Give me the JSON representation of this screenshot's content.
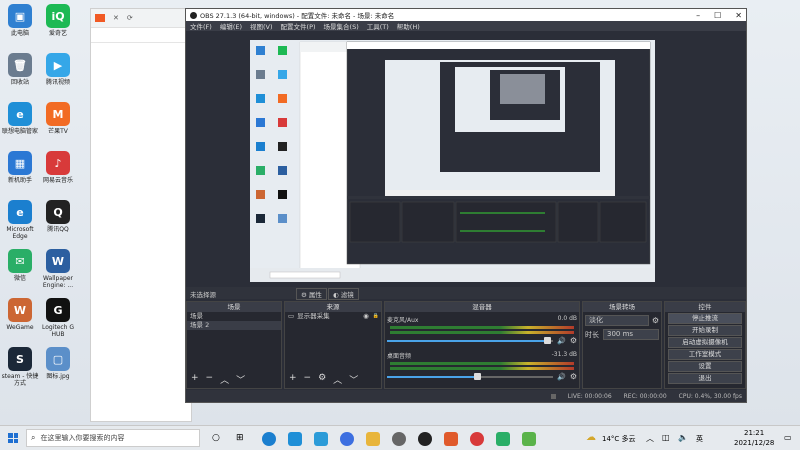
{
  "desktop_icons": [
    {
      "label": "此电脑",
      "color": "#2f80d1",
      "glyph": "▣",
      "icon": "computer-icon"
    },
    {
      "label": "爱奇艺",
      "color": "#1db954",
      "glyph": "iQ",
      "icon": "iqiyi-icon"
    },
    {
      "label": "回收站",
      "color": "#6b7c8f",
      "glyph": "🗑",
      "icon": "recycle-bin-icon"
    },
    {
      "label": "腾讯视频",
      "color": "#35a7e8",
      "glyph": "▶",
      "icon": "tencent-video-icon"
    },
    {
      "label": "联想电脑管家",
      "color": "#1f8fd7",
      "glyph": "e",
      "icon": "lenovo-manager-icon"
    },
    {
      "label": "芒果TV",
      "color": "#f26b24",
      "glyph": "M",
      "icon": "mango-tv-icon"
    },
    {
      "label": "新机助手",
      "color": "#2b78d4",
      "glyph": "▦",
      "icon": "new-pc-assistant-icon"
    },
    {
      "label": "网易云音乐",
      "color": "#d83a3a",
      "glyph": "♪",
      "icon": "netease-music-icon"
    },
    {
      "label": "Microsoft Edge",
      "color": "#1b7fcf",
      "glyph": "e",
      "icon": "edge-icon"
    },
    {
      "label": "腾讯QQ",
      "color": "#222",
      "glyph": "Q",
      "icon": "qq-icon"
    },
    {
      "label": "微信",
      "color": "#2aae67",
      "glyph": "✉",
      "icon": "wechat-icon"
    },
    {
      "label": "Wallpaper Engine: ...",
      "color": "#2c5fa0",
      "glyph": "W",
      "icon": "wallpaper-engine-icon"
    },
    {
      "label": "WeGame",
      "color": "#c63",
      "glyph": "W",
      "icon": "wegame-icon"
    },
    {
      "label": "Logitech G HUB",
      "color": "#111",
      "glyph": "G",
      "icon": "logitech-ghub-icon"
    },
    {
      "label": "steam - 快捷方式",
      "color": "#1b2838",
      "glyph": "S",
      "icon": "steam-icon"
    },
    {
      "label": "图标.jpg",
      "color": "#5b8fc9",
      "glyph": "▢",
      "icon": "jpg-file-icon"
    }
  ],
  "obs": {
    "title": "OBS 27.1.3 (64-bit, windows) - 配置文件: 未命名 - 场景: 未命名",
    "menu": [
      "文件(F)",
      "编辑(E)",
      "视图(V)",
      "配置文件(P)",
      "场景集合(S)",
      "工具(T)",
      "帮助(H)"
    ],
    "midbar": {
      "left": "未选择源",
      "props": "属性",
      "filters": "滤镜"
    },
    "panels": {
      "scenes": {
        "title": "场景",
        "items": [
          "场景",
          "场景 2"
        ]
      },
      "sources": {
        "title": "来源",
        "items": [
          "显示器采集"
        ]
      },
      "mixer": {
        "title": "混音器",
        "tracks": [
          {
            "name": "麦克风/Aux",
            "db": "0.0 dB",
            "level": 0.97
          },
          {
            "name": "桌面音频",
            "db": "-31.3 dB",
            "level": 0.55
          }
        ]
      },
      "transitions": {
        "title": "场景转场",
        "mode": "淡化",
        "duration_label": "时长",
        "duration_value": "300 ms"
      },
      "controls": {
        "title": "控件",
        "buttons": [
          "停止推流",
          "开始录制",
          "启动虚拟摄像机",
          "工作室模式",
          "设置",
          "退出"
        ]
      }
    },
    "status": {
      "live": "LIVE: 00:00:06",
      "rec": "REC: 00:00:00",
      "cpu": "CPU: 0.4%, 30.00 fps"
    }
  },
  "taskbar": {
    "search_placeholder": "在这里输入你要搜索的内容",
    "weather": "14°C 多云",
    "ime": "英",
    "time": "21:21",
    "date": "2021/12/28"
  }
}
